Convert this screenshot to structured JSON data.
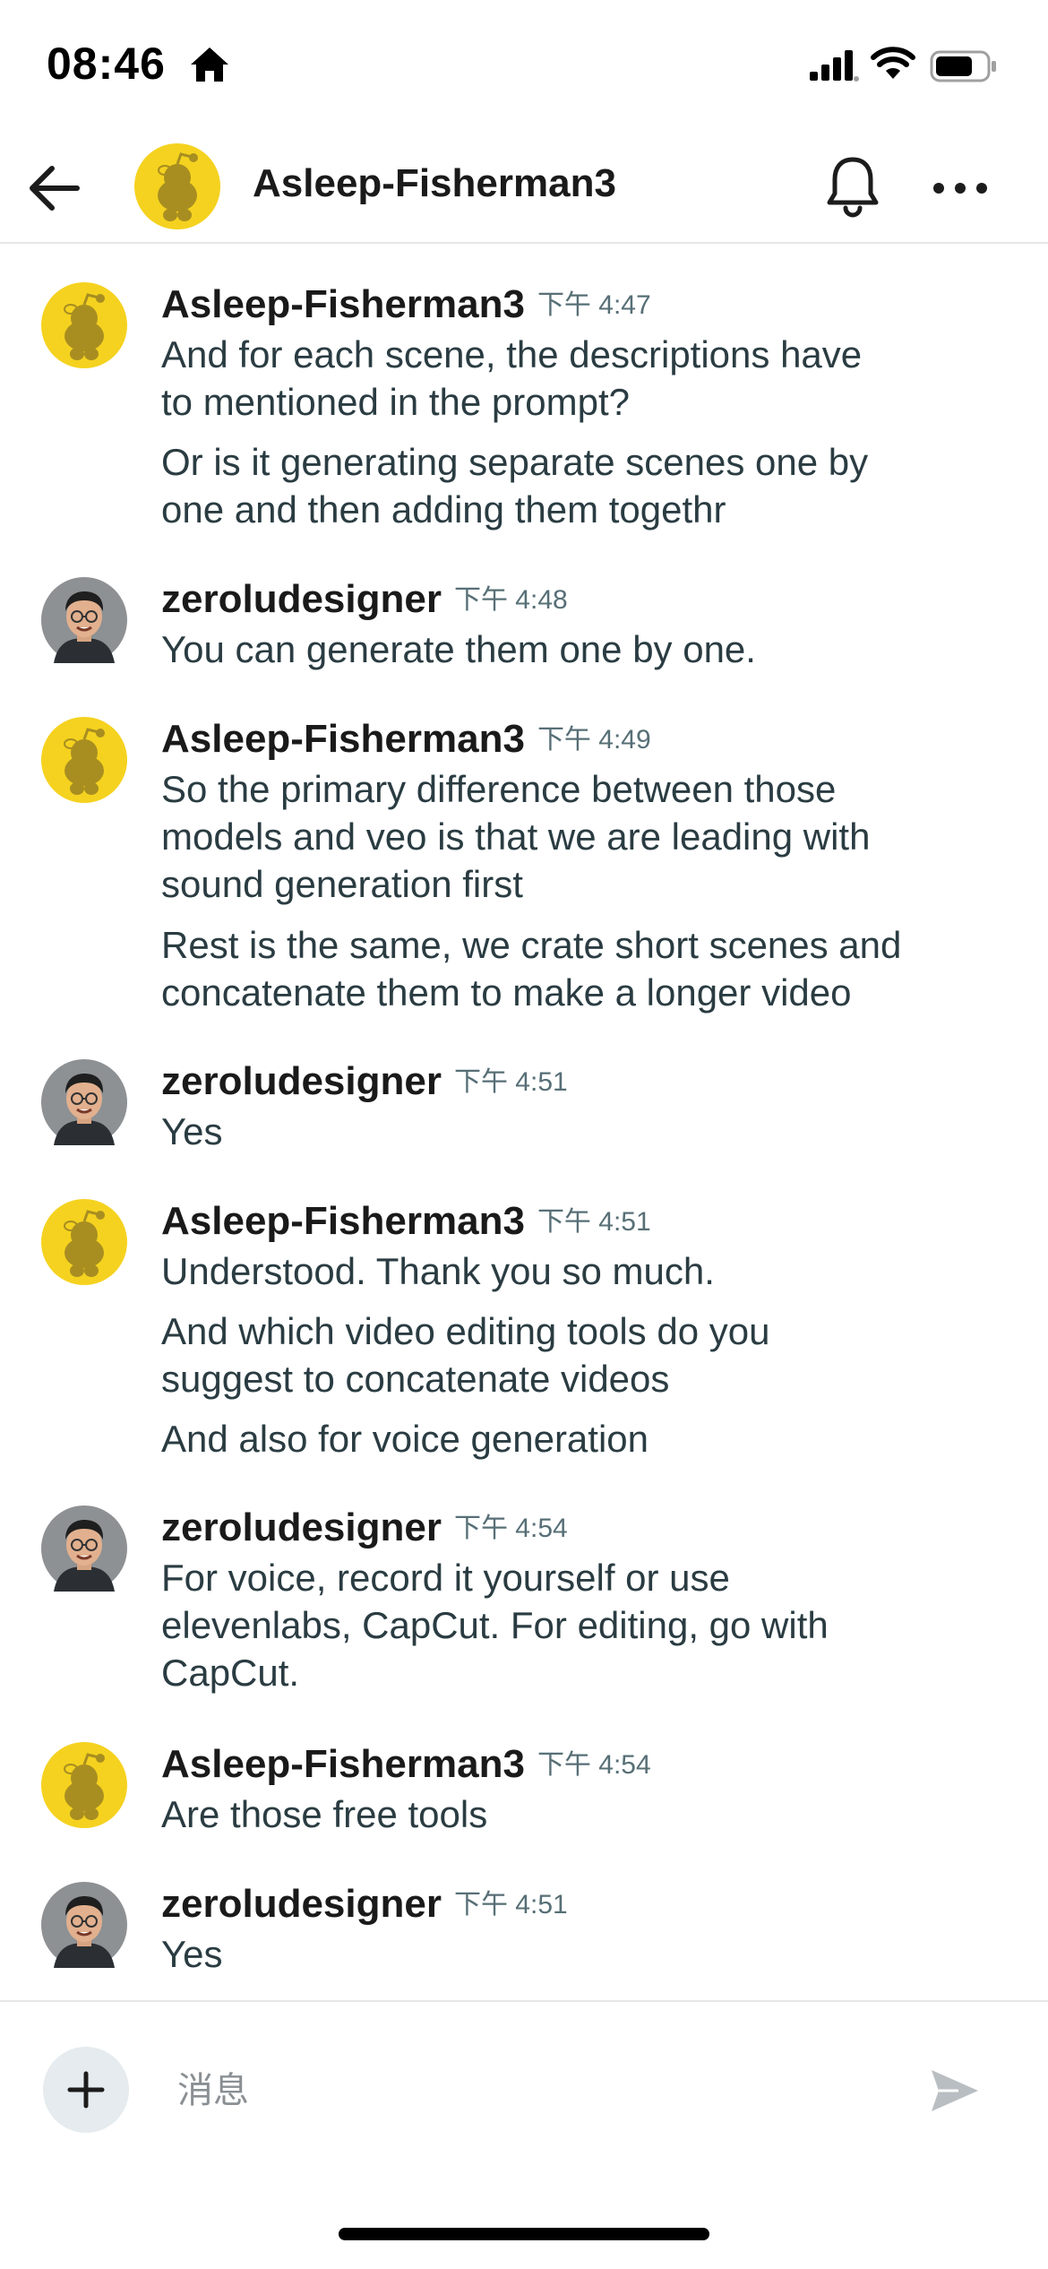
{
  "status_bar": {
    "time": "08:46"
  },
  "header": {
    "title": "Asleep-Fisherman3"
  },
  "messages": [
    {
      "author": "Asleep-Fisherman3",
      "time": "下午 4:47",
      "avatar": "reddit-snoo-avatar",
      "lines": [
        "And for each scene, the descriptions have",
        "to mentioned in the prompt?",
        "Or is it generating separate scenes one by",
        "one and then adding them togethr"
      ]
    },
    {
      "author": "zeroludesigner",
      "time": "下午 4:48",
      "avatar": "user-photo-avatar",
      "lines": [
        "You can generate them one by one."
      ]
    },
    {
      "author": "Asleep-Fisherman3",
      "time": "下午 4:49",
      "avatar": "reddit-snoo-avatar",
      "lines": [
        "So the primary difference between those",
        "models and veo is that we are leading with",
        "sound generation first",
        "Rest is the same, we crate short scenes and",
        "concatenate them to make a longer video"
      ]
    },
    {
      "author": "zeroludesigner",
      "time": "下午 4:51",
      "avatar": "user-photo-avatar",
      "lines": [
        "Yes"
      ]
    },
    {
      "author": "Asleep-Fisherman3",
      "time": "下午 4:51",
      "avatar": "reddit-snoo-avatar",
      "lines": [
        "Understood. Thank you so much.",
        "And which video editing tools do you",
        "suggest to concatenate videos",
        "And also for voice generation"
      ]
    },
    {
      "author": "zeroludesigner",
      "time": "下午 4:54",
      "avatar": "user-photo-avatar",
      "lines": [
        "For voice, record it yourself or use",
        "elevenlabs, CapCut. For editing, go with",
        "CapCut."
      ]
    },
    {
      "author": "Asleep-Fisherman3",
      "time": "下午 4:54",
      "avatar": "reddit-snoo-avatar",
      "lines": [
        "Are those free tools"
      ]
    },
    {
      "author": "zeroludesigner",
      "time": "下午 4:51",
      "avatar": "user-photo-avatar",
      "lines": [
        "Yes"
      ]
    }
  ],
  "composer": {
    "placeholder": "消息"
  },
  "icons": {
    "back": "arrow-left-icon",
    "bell": "bell-icon",
    "more": "more-horizontal-icon",
    "add": "plus-icon",
    "send": "send-icon"
  },
  "colors": {
    "snoo_yellow": "#f5d21f",
    "timestamp": "#576f76",
    "body_text": "#2a3c42"
  }
}
